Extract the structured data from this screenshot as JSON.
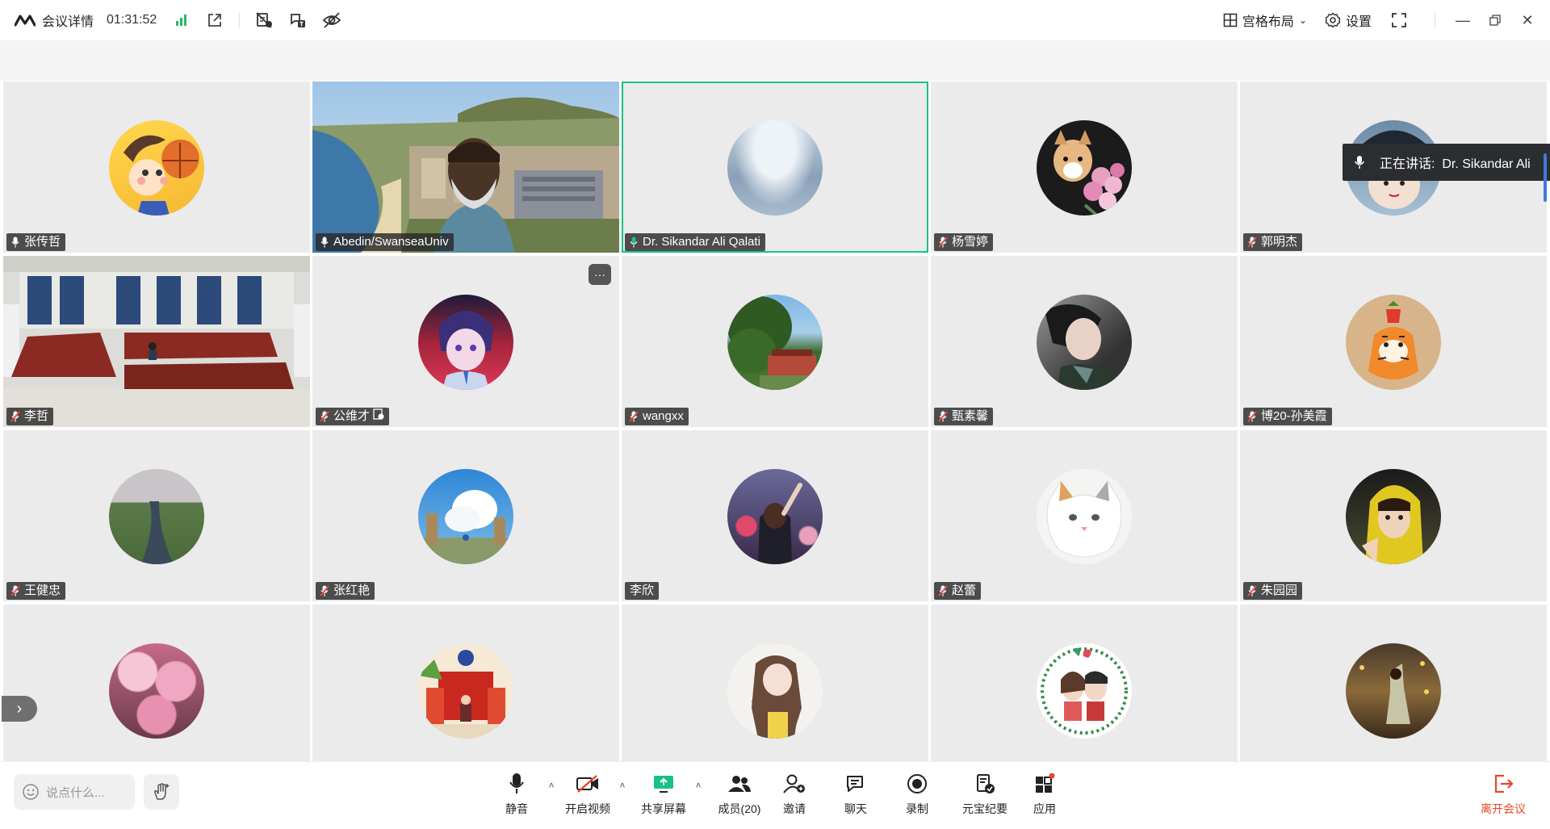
{
  "topbar": {
    "title": "会议详情",
    "time": "01:31:52",
    "layout_label": "宫格布局",
    "settings_label": "设置"
  },
  "speaker": {
    "label": "正在讲话:",
    "name": "Dr. Sikandar Ali"
  },
  "tiles": [
    {
      "name": "张传哲",
      "muted": false
    },
    {
      "name": "Abedin/SwanseaUniv",
      "muted": false
    },
    {
      "name": "Dr. Sikandar Ali Qalati",
      "muted": false
    },
    {
      "name": "杨雪婷",
      "muted": true
    },
    {
      "name": "郭明杰",
      "muted": true
    },
    {
      "name": "李哲",
      "muted": true
    },
    {
      "name": "公维才",
      "muted": true
    },
    {
      "name": "wangxx",
      "muted": true
    },
    {
      "name": "甄素馨",
      "muted": true
    },
    {
      "name": "博20-孙美霞",
      "muted": true
    },
    {
      "name": "王健忠",
      "muted": true
    },
    {
      "name": "张红艳",
      "muted": true
    },
    {
      "name": "李欣",
      "muted": false
    },
    {
      "name": "赵蕾",
      "muted": true
    },
    {
      "name": "朱园园",
      "muted": true
    }
  ],
  "chat": {
    "placeholder": "说点什么..."
  },
  "controls": {
    "mute": "静音",
    "video": "开启视频",
    "share": "共享屏幕",
    "members": "成员(20)",
    "invite": "邀请",
    "chat": "聊天",
    "record": "录制",
    "ai_summary": "元宝纪要",
    "apps": "应用",
    "leave": "离开会议"
  },
  "colors": {
    "active_border": "#19c08a",
    "leave": "#e8452a",
    "signal": "#1fba6b"
  }
}
